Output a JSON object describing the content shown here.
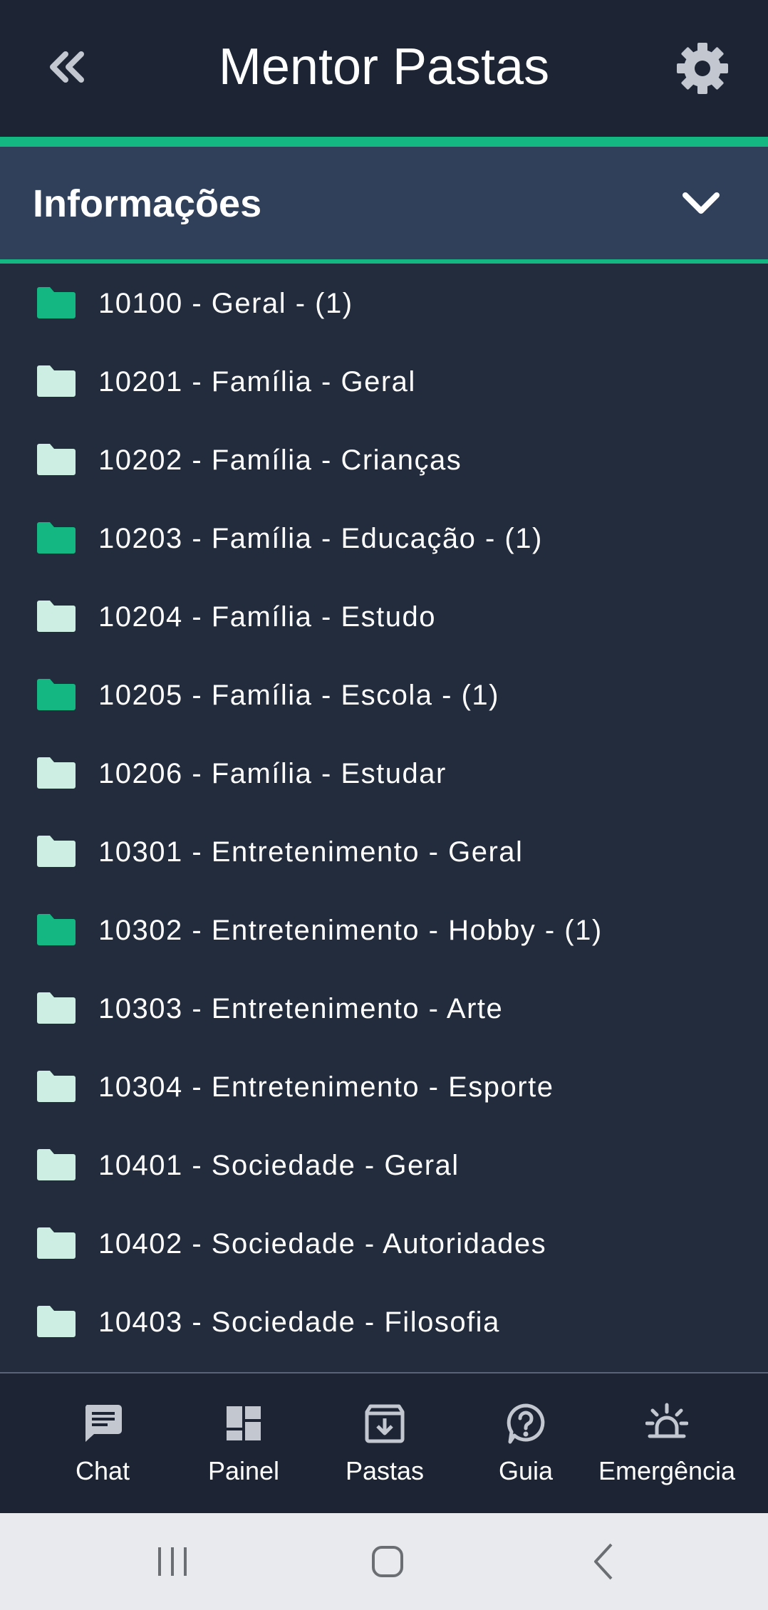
{
  "header": {
    "title": "Mentor Pastas",
    "back_icon": "double-chevron-left-icon",
    "settings_icon": "gear-icon"
  },
  "section": {
    "title": "Informações",
    "expand_icon": "chevron-down-icon"
  },
  "folders": [
    {
      "label": "10100 - Geral - (1)",
      "has_items": true
    },
    {
      "label": "10201 - Família - Geral",
      "has_items": false
    },
    {
      "label": "10202 - Família - Crianças",
      "has_items": false
    },
    {
      "label": "10203 - Família - Educação - (1)",
      "has_items": true
    },
    {
      "label": "10204 - Família - Estudo",
      "has_items": false
    },
    {
      "label": "10205 - Família - Escola - (1)",
      "has_items": true
    },
    {
      "label": "10206 - Família - Estudar",
      "has_items": false
    },
    {
      "label": "10301 - Entretenimento - Geral",
      "has_items": false
    },
    {
      "label": "10302 - Entretenimento - Hobby - (1)",
      "has_items": true
    },
    {
      "label": "10303 - Entretenimento - Arte",
      "has_items": false
    },
    {
      "label": "10304 - Entretenimento - Esporte",
      "has_items": false
    },
    {
      "label": "10401 - Sociedade - Geral",
      "has_items": false
    },
    {
      "label": "10402 - Sociedade - Autoridades",
      "has_items": false
    },
    {
      "label": "10403 - Sociedade - Filosofia",
      "has_items": false
    }
  ],
  "bottom_nav": [
    {
      "label": "Chat",
      "icon": "chat-icon"
    },
    {
      "label": "Painel",
      "icon": "dashboard-icon"
    },
    {
      "label": "Pastas",
      "icon": "archive-icon"
    },
    {
      "label": "Guia",
      "icon": "help-icon"
    },
    {
      "label": "Emergência",
      "icon": "siren-icon"
    }
  ],
  "system_nav": {
    "recents_icon": "recents-icon",
    "home_icon": "home-icon",
    "back_icon": "back-icon"
  },
  "colors": {
    "background": "#222c3d",
    "header": "#1d2535",
    "section": "#30405a",
    "accent": "#14b782",
    "folder_with_items": "#14b782",
    "folder_empty": "#cdeee3",
    "icon_gray": "#c2c7d0"
  }
}
